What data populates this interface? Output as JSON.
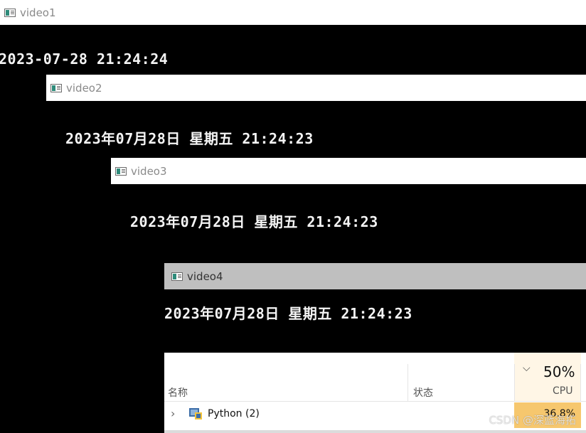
{
  "windows": [
    {
      "id": "video1",
      "title": "video1",
      "clock": "2023-07-28 21:24:24"
    },
    {
      "id": "video2",
      "title": "video2",
      "clock": "2023年07月28日 星期五 21:24:23"
    },
    {
      "id": "video3",
      "title": "video3",
      "clock": "2023年07月28日 星期五 21:24:23"
    },
    {
      "id": "video4",
      "title": "video4",
      "clock": "2023年07月28日 星期五 21:24:23"
    }
  ],
  "task_manager": {
    "col_name": "名称",
    "col_status": "状态",
    "col_cpu": "CPU",
    "cpu_total": "50%",
    "cpu_sort_icon": "chevron-down-icon",
    "rows": [
      {
        "expander_icon": "chevron-right-icon",
        "icon": "python-icon",
        "name": "Python (2)",
        "cpu": "36.8%"
      }
    ],
    "highlight_color": "#f6c76e"
  },
  "watermark": "CSDN @深蓝海拓"
}
